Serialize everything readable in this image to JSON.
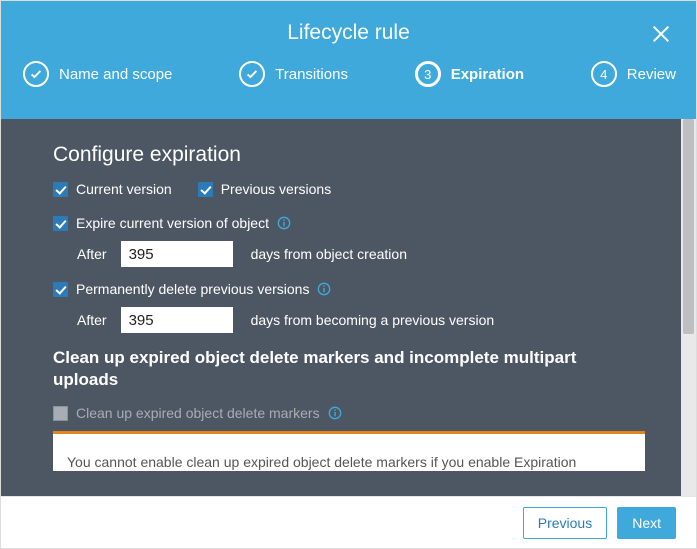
{
  "header": {
    "title": "Lifecycle rule",
    "close_label": "Close"
  },
  "steps": {
    "s1": {
      "label": "Name and scope"
    },
    "s2": {
      "label": "Transitions"
    },
    "s3": {
      "label": "Expiration",
      "number": "3"
    },
    "s4": {
      "label": "Review",
      "number": "4"
    }
  },
  "expiration": {
    "heading": "Configure expiration",
    "current_version_label": "Current version",
    "previous_versions_label": "Previous versions",
    "expire_current_label": "Expire current version of object",
    "after_label_1": "After",
    "expire_current_days": "395",
    "expire_current_suffix": "days from object creation",
    "perm_delete_label": "Permanently delete previous versions",
    "after_label_2": "After",
    "perm_delete_days": "395",
    "perm_delete_suffix": "days from becoming a previous version"
  },
  "cleanup": {
    "heading": "Clean up expired object delete markers and incomplete multipart uploads",
    "delete_markers_label": "Clean up expired object delete markers",
    "notice": "You cannot enable clean up expired object delete markers if you enable Expiration"
  },
  "footer": {
    "previous": "Previous",
    "next": "Next"
  }
}
